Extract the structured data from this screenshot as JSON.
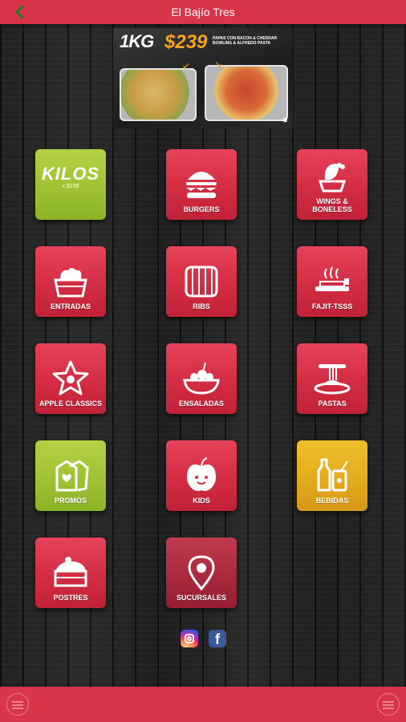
{
  "header": {
    "title": "El Bajío Tres",
    "back_icon": "chevron-left-icon"
  },
  "banner": {
    "weight": "1KG",
    "price": "$239",
    "description": "PAPAS CON BACON & CHEDDAR BOWLING & ALFREDO PASTA"
  },
  "tiles": [
    {
      "id": "kilos",
      "label": "KILOS",
      "sublabel": "x $239",
      "color": "green",
      "icon": "kilos-logo"
    },
    {
      "id": "burgers",
      "label": "BURGERS",
      "color": "red",
      "icon": "burger-icon"
    },
    {
      "id": "wings",
      "label": "WINGS & BONELESS",
      "color": "red",
      "icon": "chicken-wing-icon"
    },
    {
      "id": "entradas",
      "label": "ENTRADAS",
      "color": "red",
      "icon": "appetizer-basket-icon"
    },
    {
      "id": "ribs",
      "label": "RIBS",
      "color": "red",
      "icon": "ribs-icon"
    },
    {
      "id": "fajitsss",
      "label": "FAJIT-TSSS",
      "color": "red",
      "icon": "sizzling-fajita-icon"
    },
    {
      "id": "apple-classics",
      "label": "APPLE CLASSICS",
      "color": "red",
      "icon": "star-apple-icon"
    },
    {
      "id": "ensaladas",
      "label": "ENSALADAS",
      "color": "red",
      "icon": "salad-bowl-icon"
    },
    {
      "id": "pastas",
      "label": "PASTAS",
      "color": "red",
      "icon": "pasta-plate-icon"
    },
    {
      "id": "promos",
      "label": "PROMOS",
      "color": "green",
      "icon": "price-tag-icon"
    },
    {
      "id": "kids",
      "label": "KIDS",
      "color": "red",
      "icon": "apple-face-icon"
    },
    {
      "id": "bebidas",
      "label": "BEBIDAS",
      "color": "yellow",
      "icon": "drinks-icon"
    },
    {
      "id": "postres",
      "label": "POSTRES",
      "color": "red",
      "icon": "cake-slice-icon"
    },
    {
      "id": "sucursales",
      "label": "SUCURSALES",
      "color": "dark",
      "icon": "map-pin-icon"
    }
  ],
  "social": {
    "instagram": "instagram-icon",
    "facebook_glyph": "f"
  },
  "colors": {
    "bar": "#d8344a",
    "red_tile": "#d22d43",
    "green_tile": "#9dc131",
    "yellow_tile": "#e3a91c",
    "back_arrow": "#1f7a28"
  }
}
